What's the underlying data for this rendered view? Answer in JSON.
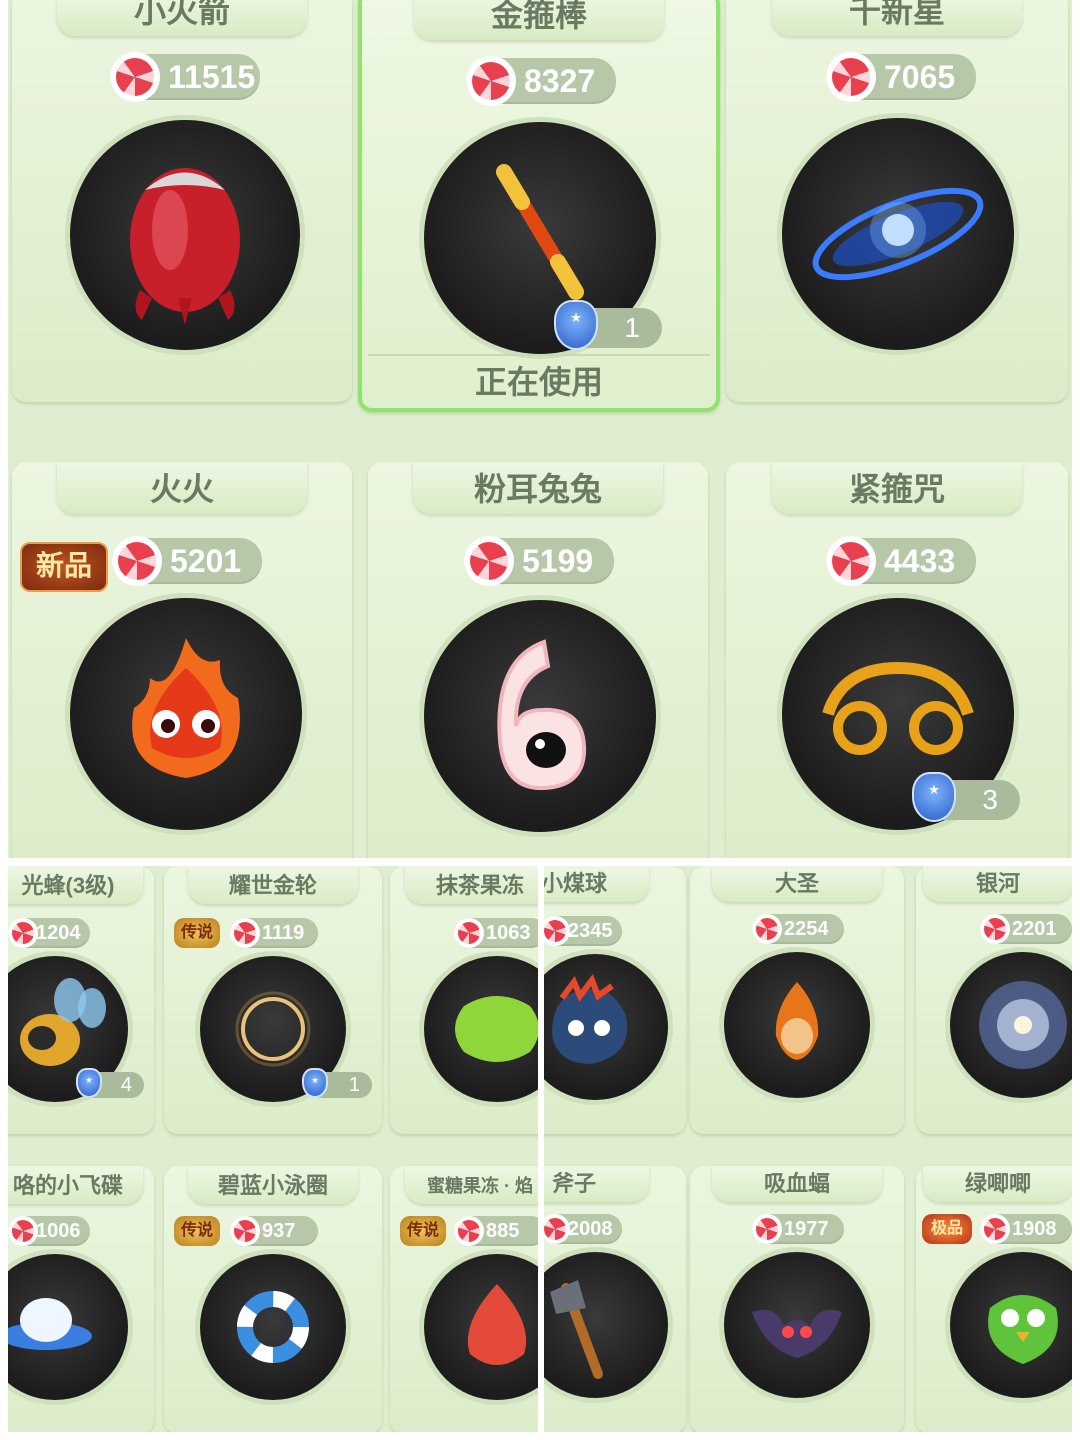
{
  "top_items": [
    {
      "name": "小火箭",
      "price": "11515"
    },
    {
      "name": "金箍棒",
      "price": "8327",
      "level": "1",
      "status": "正在使用"
    },
    {
      "name": "千新星",
      "price": "7065"
    },
    {
      "name": "火火",
      "price": "5201",
      "tag": "新品"
    },
    {
      "name": "粉耳兔兔",
      "price": "5199"
    },
    {
      "name": "紧箍咒",
      "price": "4433",
      "level": "3"
    }
  ],
  "bottom_left_items": [
    {
      "name": "光蜂(3级)",
      "price": "1204",
      "level": "4"
    },
    {
      "name": "耀世金轮",
      "price": "1119",
      "level": "1",
      "tag": "传说"
    },
    {
      "name": "抹茶果冻",
      "price": "1063"
    },
    {
      "name": "咯的小飞碟",
      "price": "1006"
    },
    {
      "name": "碧蓝小泳圈",
      "price": "937",
      "tag": "传说"
    },
    {
      "name": "蜜糖果冻 · 焰",
      "price": "885",
      "tag": "传说"
    }
  ],
  "bottom_right_items": [
    {
      "name": "小煤球",
      "price": "2345"
    },
    {
      "name": "大圣",
      "price": "2254"
    },
    {
      "name": "银河",
      "price": "2201"
    },
    {
      "name": "斧子",
      "price": "2008"
    },
    {
      "name": "吸血蝠",
      "price": "1977"
    },
    {
      "name": "绿唧唧",
      "price": "1908",
      "tag": "极品"
    }
  ]
}
